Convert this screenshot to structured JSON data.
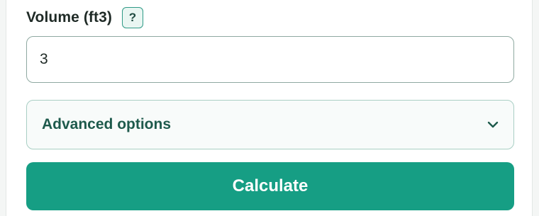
{
  "volume_field": {
    "label": "Volume (ft3)",
    "help_label": "?",
    "value": "3"
  },
  "advanced": {
    "label": "Advanced options",
    "icon": "chevron-down-icon"
  },
  "actions": {
    "calculate_label": "Calculate"
  },
  "colors": {
    "accent": "#169e84",
    "accent_text": "#1e5a4c",
    "label_text": "#1f2a26"
  }
}
